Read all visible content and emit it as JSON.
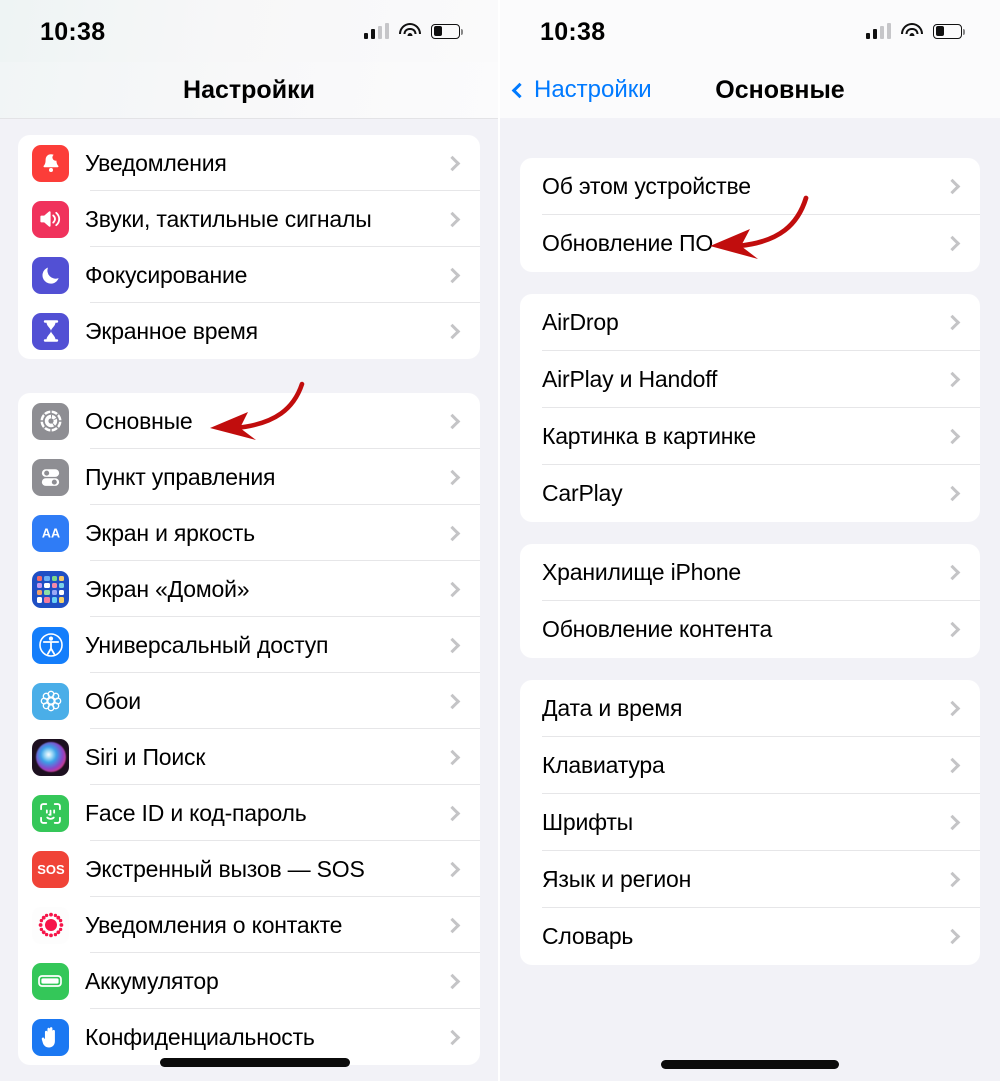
{
  "left": {
    "status": {
      "time": "10:38",
      "battery_pct": 36
    },
    "nav": {
      "title": "Настройки"
    },
    "groups": [
      {
        "rows": [
          {
            "label": "Уведомления",
            "icon": "notifications-icon"
          },
          {
            "label": "Звуки, тактильные сигналы",
            "icon": "sounds-icon"
          },
          {
            "label": "Фокусирование",
            "icon": "focus-icon"
          },
          {
            "label": "Экранное время",
            "icon": "screen-time-icon"
          }
        ]
      },
      {
        "rows": [
          {
            "label": "Основные",
            "icon": "general-gear-icon"
          },
          {
            "label": "Пункт управления",
            "icon": "control-center-icon"
          },
          {
            "label": "Экран и яркость",
            "icon": "display-brightness-icon"
          },
          {
            "label": "Экран «Домой»",
            "icon": "home-screen-icon"
          },
          {
            "label": "Универсальный доступ",
            "icon": "accessibility-icon"
          },
          {
            "label": "Обои",
            "icon": "wallpaper-icon"
          },
          {
            "label": "Siri и Поиск",
            "icon": "siri-icon"
          },
          {
            "label": "Face ID и код-пароль",
            "icon": "face-id-icon"
          },
          {
            "label": "Экстренный вызов — SOS",
            "icon": "sos-icon"
          },
          {
            "label": "Уведомления о контакте",
            "icon": "contact-alerts-icon"
          },
          {
            "label": "Аккумулятор",
            "icon": "battery-icon"
          },
          {
            "label": "Конфиденциальность",
            "icon": "privacy-hand-icon"
          }
        ]
      }
    ]
  },
  "right": {
    "status": {
      "time": "10:38",
      "battery_pct": 36
    },
    "nav": {
      "back_label": "Настройки",
      "title": "Основные"
    },
    "groups": [
      {
        "rows": [
          {
            "label": "Об этом устройстве"
          },
          {
            "label": "Обновление ПО"
          }
        ]
      },
      {
        "rows": [
          {
            "label": "AirDrop"
          },
          {
            "label": "AirPlay и Handoff"
          },
          {
            "label": "Картинка в картинке"
          },
          {
            "label": "CarPlay"
          }
        ]
      },
      {
        "rows": [
          {
            "label": "Хранилище iPhone"
          },
          {
            "label": "Обновление контента"
          }
        ]
      },
      {
        "rows": [
          {
            "label": "Дата и время"
          },
          {
            "label": "Клавиатура"
          },
          {
            "label": "Шрифты"
          },
          {
            "label": "Язык и регион"
          },
          {
            "label": "Словарь"
          }
        ]
      }
    ]
  },
  "annotations": {
    "accent_color": "#c10d0d",
    "arrows": [
      {
        "name": "arrow-pointing-to-general",
        "target": "Основные"
      },
      {
        "name": "arrow-pointing-to-software-update",
        "target": "Обновление ПО"
      }
    ]
  }
}
